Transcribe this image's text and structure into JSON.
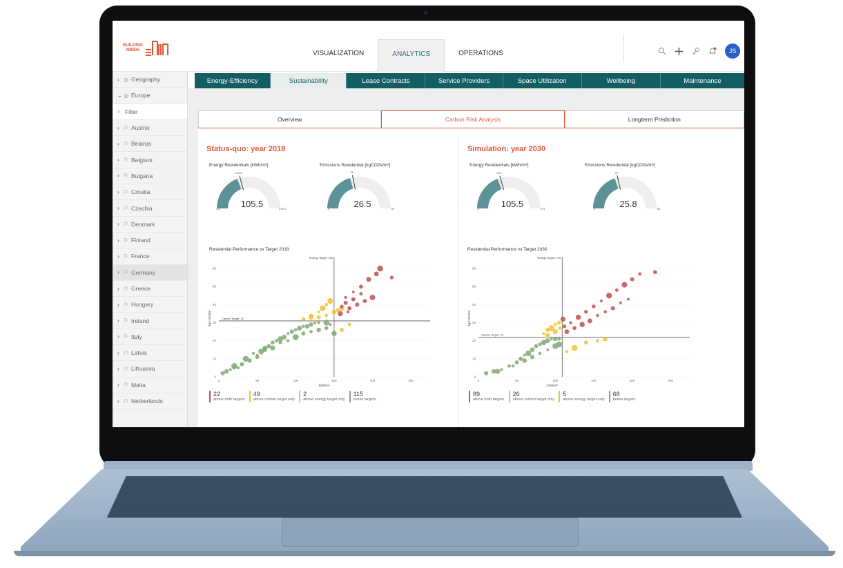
{
  "colors": {
    "accent": "#e05a3a",
    "teal": "#135e63",
    "gauge": "#5d9397",
    "red": "#c0504d",
    "yellow": "#f1c232",
    "green": "#7fa872"
  },
  "logo": {
    "line1": "BUILDING",
    "line2": "MINDS"
  },
  "mainnav": [
    {
      "label": "VISUALIZATION"
    },
    {
      "label": "ANALYTICS"
    },
    {
      "label": "OPERATIONS"
    }
  ],
  "user": {
    "initials": "JS"
  },
  "icons": {
    "search": "search-icon",
    "add": "plus-icon",
    "key": "key-icon",
    "bell": "bell-icon"
  },
  "sidebar": {
    "items": [
      {
        "label": "Geography",
        "chev": "›"
      },
      {
        "label": "Europe",
        "chev": "⌄"
      }
    ],
    "filter_placeholder": "Filter",
    "countries": [
      {
        "label": "Austria"
      },
      {
        "label": "Belarus"
      },
      {
        "label": "Belgium"
      },
      {
        "label": "Bulgaria"
      },
      {
        "label": "Croatia"
      },
      {
        "label": "Czechia"
      },
      {
        "label": "Denmark"
      },
      {
        "label": "Finland"
      },
      {
        "label": "France"
      },
      {
        "label": "Germany"
      },
      {
        "label": "Greece"
      },
      {
        "label": "Hungary"
      },
      {
        "label": "Ireland"
      },
      {
        "label": "Italy"
      },
      {
        "label": "Latvia"
      },
      {
        "label": "Lithuania"
      },
      {
        "label": "Malta"
      },
      {
        "label": "Netherlands"
      }
    ]
  },
  "subnav": [
    {
      "label": "Energy-Efficiency"
    },
    {
      "label": "Sustainability"
    },
    {
      "label": "Lease Contracts"
    },
    {
      "label": "Service Providers"
    },
    {
      "label": "Space Utilization"
    },
    {
      "label": "Wellbeing"
    },
    {
      "label": "Maintenance"
    }
  ],
  "tabs": [
    {
      "label": "Overview"
    },
    {
      "label": "Carbon Risk Analysis"
    },
    {
      "label": "Longterm Prediction"
    }
  ],
  "left": {
    "title": "Status-quo: year 2018",
    "gauge1": {
      "label": "Energy Residentials [kWh/m²]",
      "value": "105.5",
      "min": "0.0",
      "max": "275.0",
      "target": "134.8",
      "fraction": 0.384
    },
    "gauge2": {
      "label": "Emissions Residential [kgCO2e/m²]",
      "value": "26.5",
      "min": "0",
      "max": "65",
      "target": "31",
      "fraction": 0.408
    },
    "plot_title": "Residential Performance vs Target 2018",
    "energy_target_label": "Energy Target: 150",
    "carbon_target_label": "Carbon Target: 31",
    "stats": [
      {
        "num": "22",
        "label": "above both targets",
        "color": "#c0504d"
      },
      {
        "num": "49",
        "label": "above carbon target only",
        "color": "#f1c232"
      },
      {
        "num": "2",
        "label": "above energy target only",
        "color": "#f1c232"
      },
      {
        "num": "115",
        "label": "below targets",
        "color": "#7fa872"
      }
    ]
  },
  "right": {
    "title": "Simulation: year 2030",
    "gauge1": {
      "label": "Energy Residentials [kWh/m²]",
      "value": "105.5",
      "min": "0",
      "max": "275",
      "target": "109",
      "fraction": 0.384
    },
    "gauge2": {
      "label": "Emissions Residential [kgCO2e/m²]",
      "value": "25.8",
      "min": "0",
      "max": "65",
      "target": "22",
      "fraction": 0.397
    },
    "plot_title": "Residential Performance vs Target 2030",
    "energy_target_label": "Energy Target: 109",
    "carbon_target_label": "Carbon Target: 22",
    "stats": [
      {
        "num": "89",
        "label": "above both targets",
        "color": "#c0504d"
      },
      {
        "num": "26",
        "label": "above carbon target only",
        "color": "#f1c232"
      },
      {
        "num": "5",
        "label": "above energy target only",
        "color": "#f1c232"
      },
      {
        "num": "68",
        "label": "below targets",
        "color": "#7fa872"
      }
    ]
  },
  "chart_data": [
    {
      "type": "scatter",
      "title": "Residential Performance vs Target 2018",
      "xlabel": "kWh/m²",
      "ylabel": "kgCO2e/m²",
      "xlim": [
        0,
        275
      ],
      "ylim": [
        0,
        65
      ],
      "xticks": [
        "0",
        "50",
        "100",
        "150",
        "200",
        "250"
      ],
      "yticks": [
        "0",
        "10",
        "20",
        "30",
        "40",
        "50",
        "60"
      ],
      "energy_target": 150,
      "carbon_target": 31,
      "series": [
        {
          "name": "below targets",
          "color": "#7fa872",
          "points": [
            [
              5,
              2
            ],
            [
              10,
              3
            ],
            [
              15,
              4
            ],
            [
              20,
              5
            ],
            [
              30,
              7
            ],
            [
              40,
              9
            ],
            [
              50,
              12
            ],
            [
              55,
              14
            ],
            [
              60,
              16
            ],
            [
              70,
              19
            ],
            [
              75,
              20
            ],
            [
              80,
              21
            ],
            [
              85,
              22
            ],
            [
              90,
              24
            ],
            [
              95,
              25
            ],
            [
              100,
              26
            ],
            [
              105,
              27
            ],
            [
              110,
              28
            ],
            [
              115,
              28
            ],
            [
              120,
              29
            ],
            [
              125,
              30
            ],
            [
              130,
              30
            ],
            [
              140,
              30
            ],
            [
              35,
              10
            ],
            [
              45,
              13
            ],
            [
              65,
              17
            ],
            [
              20,
              6
            ],
            [
              25,
              5
            ],
            [
              50,
              11
            ],
            [
              60,
              15
            ],
            [
              70,
              16
            ],
            [
              80,
              19
            ],
            [
              90,
              20
            ],
            [
              100,
              22
            ],
            [
              110,
              24
            ],
            [
              120,
              25
            ],
            [
              130,
              26
            ],
            [
              140,
              27
            ],
            [
              145,
              29
            ],
            [
              150,
              24
            ]
          ]
        },
        {
          "name": "above carbon target only",
          "color": "#f1c232",
          "points": [
            [
              110,
              32
            ],
            [
              120,
              34
            ],
            [
              130,
              36
            ],
            [
              135,
              38
            ],
            [
              140,
              40
            ],
            [
              145,
              42
            ],
            [
              130,
              33
            ],
            [
              140,
              34
            ],
            [
              150,
              36
            ],
            [
              155,
              37
            ],
            [
              160,
              38
            ],
            [
              120,
              33
            ],
            [
              125,
              31
            ]
          ]
        },
        {
          "name": "above energy target only",
          "color": "#f1c232",
          "points": [
            [
              170,
              29
            ],
            [
              160,
              26
            ]
          ]
        },
        {
          "name": "above both targets",
          "color": "#c0504d",
          "points": [
            [
              165,
              44
            ],
            [
              175,
              47
            ],
            [
              185,
              50
            ],
            [
              195,
              54
            ],
            [
              205,
              57
            ],
            [
              210,
              60
            ],
            [
              225,
              55
            ],
            [
              170,
              38
            ],
            [
              180,
              40
            ],
            [
              190,
              42
            ],
            [
              200,
              44
            ],
            [
              165,
              41
            ],
            [
              175,
              43
            ],
            [
              185,
              46
            ],
            [
              160,
              39
            ],
            [
              158,
              35
            ],
            [
              168,
              36
            ]
          ]
        }
      ]
    },
    {
      "type": "scatter",
      "title": "Residential Performance vs Target 2030",
      "xlabel": "kWh/m²",
      "ylabel": "kgCO2e/m²",
      "xlim": [
        0,
        275
      ],
      "ylim": [
        0,
        65
      ],
      "xticks": [
        "0",
        "50",
        "100",
        "150",
        "200",
        "250"
      ],
      "yticks": [
        "0",
        "10",
        "20",
        "30",
        "40",
        "50",
        "60"
      ],
      "energy_target": 109,
      "carbon_target": 22,
      "series": [
        {
          "name": "below targets",
          "color": "#7fa872",
          "points": [
            [
              10,
              2
            ],
            [
              20,
              3
            ],
            [
              30,
              4
            ],
            [
              40,
              6
            ],
            [
              50,
              8
            ],
            [
              55,
              10
            ],
            [
              60,
              12
            ],
            [
              65,
              13
            ],
            [
              70,
              15
            ],
            [
              75,
              17
            ],
            [
              80,
              18
            ],
            [
              85,
              19
            ],
            [
              90,
              20
            ],
            [
              95,
              21
            ],
            [
              100,
              21
            ],
            [
              105,
              21
            ],
            [
              25,
              3
            ],
            [
              45,
              6
            ],
            [
              60,
              9
            ],
            [
              70,
              11
            ],
            [
              80,
              13
            ],
            [
              90,
              15
            ],
            [
              100,
              17
            ],
            [
              105,
              18
            ]
          ]
        },
        {
          "name": "above carbon target only",
          "color": "#f1c232",
          "points": [
            [
              85,
              24
            ],
            [
              90,
              26
            ],
            [
              95,
              27
            ],
            [
              100,
              29
            ],
            [
              105,
              30
            ],
            [
              90,
              23
            ],
            [
              100,
              25
            ],
            [
              106,
              27
            ]
          ]
        },
        {
          "name": "above energy target only",
          "color": "#f1c232",
          "points": [
            [
              115,
              14
            ],
            [
              125,
              16
            ],
            [
              140,
              19
            ],
            [
              155,
              20
            ],
            [
              165,
              21
            ]
          ]
        },
        {
          "name": "above both targets",
          "color": "#c0504d",
          "points": [
            [
              112,
              28
            ],
            [
              120,
              30
            ],
            [
              130,
              33
            ],
            [
              140,
              36
            ],
            [
              150,
              39
            ],
            [
              160,
              42
            ],
            [
              170,
              45
            ],
            [
              180,
              48
            ],
            [
              190,
              51
            ],
            [
              200,
              54
            ],
            [
              210,
              57
            ],
            [
              115,
              25
            ],
            [
              125,
              27
            ],
            [
              135,
              29
            ],
            [
              145,
              31
            ],
            [
              155,
              34
            ],
            [
              165,
              36
            ],
            [
              175,
              38
            ],
            [
              185,
              41
            ],
            [
              195,
              43
            ],
            [
              230,
              58
            ],
            [
              110,
              32
            ]
          ]
        }
      ]
    }
  ]
}
